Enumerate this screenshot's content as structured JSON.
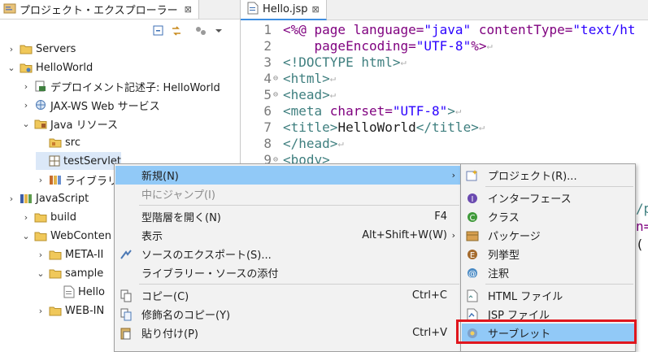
{
  "explorer": {
    "tab_title": "プロジェクト・エクスプローラー",
    "tab_close": "⊠",
    "tree": [
      {
        "label": "Servers",
        "twisty": "›",
        "icon": "folder-icon"
      },
      {
        "label": "HelloWorld",
        "twisty": "⌄",
        "icon": "project-icon"
      },
      {
        "label": "デプロイメント記述子: HelloWorld",
        "twisty": "›",
        "icon": "descriptor-icon"
      },
      {
        "label": "JAX-WS Web サービス",
        "twisty": "›",
        "icon": "webservice-icon"
      },
      {
        "label": "Java リソース",
        "twisty": "⌄",
        "icon": "java-resources-icon"
      },
      {
        "label": "src",
        "twisty": "",
        "icon": "package-folder-icon"
      },
      {
        "label": "testServlet",
        "twisty": "",
        "icon": "package-icon"
      },
      {
        "label": "ライブラリ",
        "twisty": "›",
        "icon": "library-icon"
      },
      {
        "label": "JavaScript",
        "twisty": "›",
        "icon": "javascript-icon"
      },
      {
        "label": "build",
        "twisty": "›",
        "icon": "folder-icon"
      },
      {
        "label": "WebConten",
        "twisty": "⌄",
        "icon": "folder-icon"
      },
      {
        "label": "META-II",
        "twisty": "›",
        "icon": "folder-icon"
      },
      {
        "label": "sample",
        "twisty": "⌄",
        "icon": "folder-icon"
      },
      {
        "label": "Hello",
        "twisty": "",
        "icon": "file-icon"
      },
      {
        "label": "WEB-IN",
        "twisty": "›",
        "icon": "folder-icon"
      }
    ]
  },
  "editor": {
    "tab_title": "Hello.jsp",
    "tab_close": "⊠",
    "lines": [
      {
        "num": "1",
        "parts": [
          [
            "kw",
            "<%@ "
          ],
          [
            "attr",
            "page language="
          ],
          [
            "str",
            "\"java\""
          ],
          [
            "attr",
            " contentType="
          ],
          [
            "str",
            "\"text/ht"
          ]
        ]
      },
      {
        "num": "2",
        "parts": [
          [
            "attr",
            "    pageEncoding="
          ],
          [
            "str",
            "\"UTF-8\""
          ],
          [
            "kw",
            "%>"
          ],
          [
            "ret",
            "↵"
          ]
        ]
      },
      {
        "num": "3",
        "parts": [
          [
            "tag",
            "<!DOCTYPE html>"
          ],
          [
            "ret",
            "↵"
          ]
        ]
      },
      {
        "num": "4",
        "fold": "⊖",
        "parts": [
          [
            "tag",
            "<html>"
          ],
          [
            "ret",
            "↵"
          ]
        ]
      },
      {
        "num": "5",
        "fold": "⊖",
        "parts": [
          [
            "tag",
            "<head>"
          ],
          [
            "ret",
            "↵"
          ]
        ]
      },
      {
        "num": "6",
        "parts": [
          [
            "tag",
            "<meta "
          ],
          [
            "attr",
            "charset="
          ],
          [
            "str",
            "\"UTF-8\""
          ],
          [
            "tag",
            ">"
          ],
          [
            "ret",
            "↵"
          ]
        ]
      },
      {
        "num": "7",
        "parts": [
          [
            "tag",
            "<title>"
          ],
          [
            "txt",
            "HelloWorld"
          ],
          [
            "tag",
            "</title>"
          ],
          [
            "ret",
            "↵"
          ]
        ]
      },
      {
        "num": "8",
        "parts": [
          [
            "tag",
            "</head>"
          ],
          [
            "ret",
            "↵"
          ]
        ]
      },
      {
        "num": "9",
        "fold": "⊖",
        "parts": [
          [
            "tag",
            "<body>"
          ]
        ]
      }
    ],
    "tail_fragments": [
      "/p",
      "n=",
      "("
    ]
  },
  "context_menu": {
    "items": [
      {
        "label": "新規(N)",
        "shortcut": "",
        "arrow": "›",
        "icon": "",
        "state": "highlighted"
      },
      {
        "label": "中にジャンプ(I)",
        "shortcut": "",
        "arrow": "",
        "icon": "",
        "state": "disabled"
      },
      {
        "sep": true
      },
      {
        "label": "型階層を開く(N)",
        "shortcut": "F4",
        "arrow": "",
        "icon": "",
        "state": "normal"
      },
      {
        "label": "表示",
        "shortcut": "Alt+Shift+W(W)",
        "arrow": "›",
        "icon": "",
        "state": "normal"
      },
      {
        "label": "ソースのエクスポート(S)...",
        "shortcut": "",
        "arrow": "",
        "icon": "export-icon",
        "state": "normal"
      },
      {
        "label": "ライブラリー・ソースの添付",
        "shortcut": "",
        "arrow": "",
        "icon": "",
        "state": "normal"
      },
      {
        "sep": true
      },
      {
        "label": "コピー(C)",
        "shortcut": "Ctrl+C",
        "arrow": "",
        "icon": "copy-icon",
        "state": "normal"
      },
      {
        "label": "修飾名のコピー(Y)",
        "shortcut": "",
        "arrow": "",
        "icon": "copy-qualified-icon",
        "state": "normal"
      },
      {
        "label": "貼り付け(P)",
        "shortcut": "Ctrl+V",
        "arrow": "",
        "icon": "paste-icon",
        "state": "normal"
      }
    ]
  },
  "sub_menu": {
    "items": [
      {
        "label": "プロジェクト(R)...",
        "icon": "new-project-icon"
      },
      {
        "sep": true
      },
      {
        "label": "インターフェース",
        "icon": "interface-icon"
      },
      {
        "label": "クラス",
        "icon": "class-icon"
      },
      {
        "label": "パッケージ",
        "icon": "package-icon"
      },
      {
        "label": "列挙型",
        "icon": "enum-icon"
      },
      {
        "label": "注釈",
        "icon": "annotation-icon"
      },
      {
        "sep": true
      },
      {
        "label": "HTML ファイル",
        "icon": "html-file-icon"
      },
      {
        "label": "JSP ファイル",
        "icon": "jsp-file-icon"
      },
      {
        "label": "サーブレット",
        "icon": "servlet-icon",
        "state": "highlighted"
      }
    ]
  },
  "colors": {
    "menu_highlight": "#91c9f7",
    "callout_border": "#e0161d",
    "selection": "#dbe8f8"
  }
}
